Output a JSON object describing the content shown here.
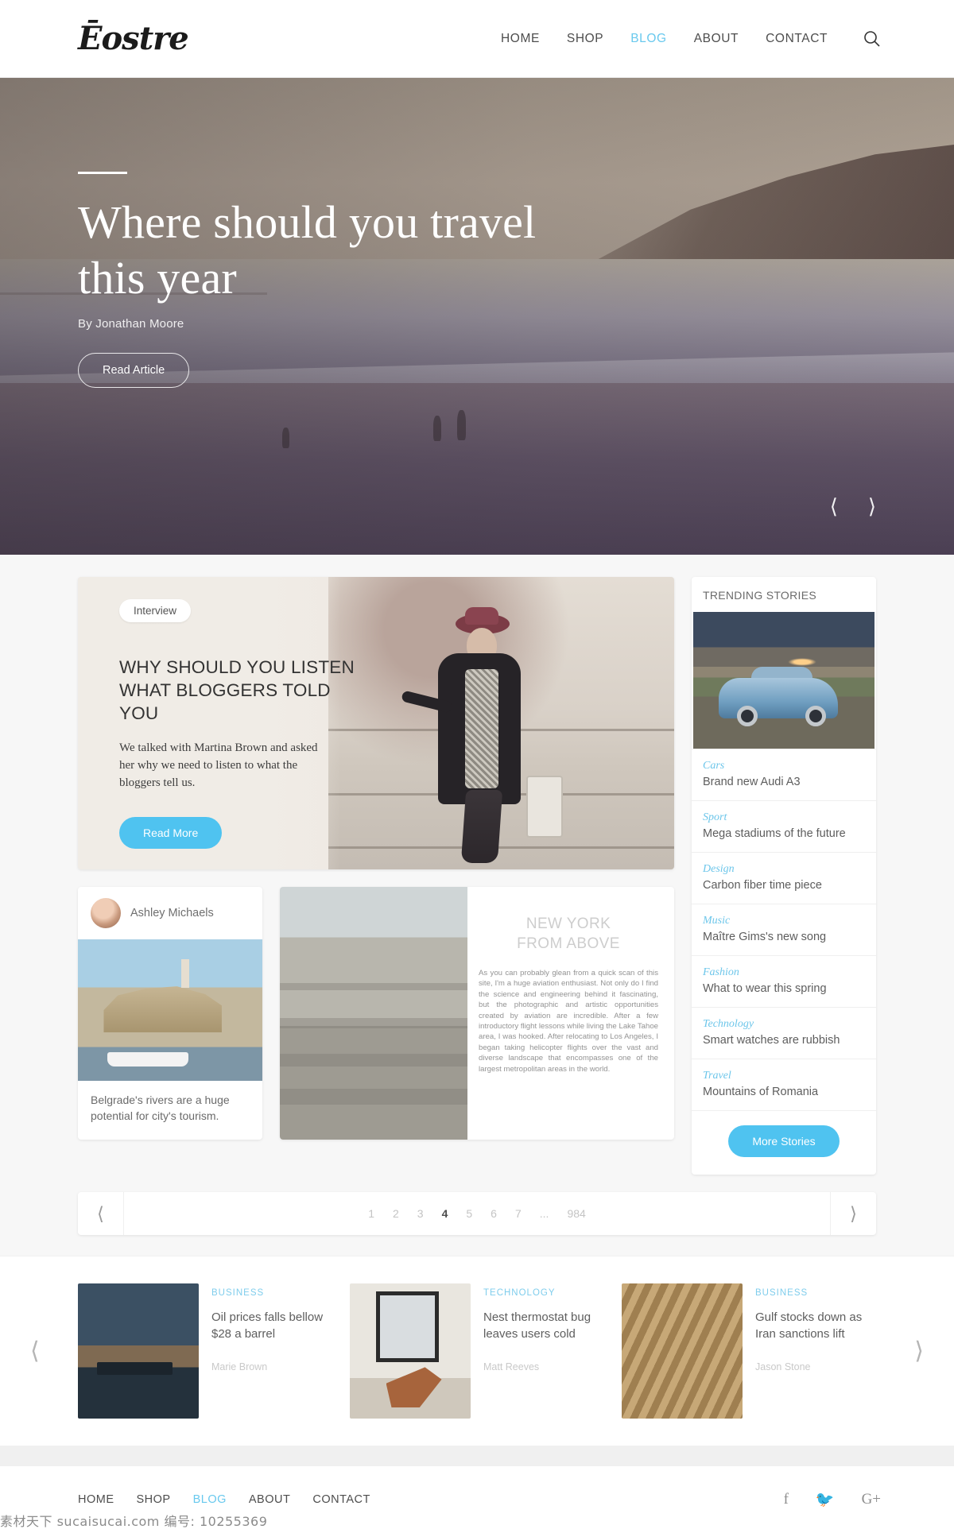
{
  "header": {
    "logo": "Ēostre",
    "nav": [
      {
        "label": "HOME",
        "active": false
      },
      {
        "label": "SHOP",
        "active": false
      },
      {
        "label": "BLOG",
        "active": true
      },
      {
        "label": "ABOUT",
        "active": false
      },
      {
        "label": "CONTACT",
        "active": false
      }
    ],
    "search_icon": "search-icon"
  },
  "hero": {
    "title": "Where should you travel this year",
    "byline": "By Jonathan Moore",
    "cta": "Read Article",
    "prev_icon": "chevron-left-icon",
    "next_icon": "chevron-right-icon"
  },
  "feature": {
    "tag": "Interview",
    "title": "WHY SHOULD YOU LISTEN WHAT BLOGGERS TOLD YOU",
    "description": "We talked with Martina Brown and asked her why we need to listen to what the bloggers tell us.",
    "cta": "Read More"
  },
  "author_card": {
    "name": "Ashley Michaels",
    "caption": "Belgrade's rivers are a huge potential for city's tourism."
  },
  "article_card": {
    "kicker_line1": "NEW YORK",
    "kicker_line2": "FROM ABOVE",
    "body": "As you can probably glean from a quick scan of this site, I'm a huge aviation enthusiast. Not only do I find the science and engineering behind it fascinating, but the photographic and artistic opportunities created by aviation are incredible. After a few introductory flight lessons while living the Lake Tahoe area, I was hooked. After relocating to Los Angeles, I began taking helicopter flights over the vast and diverse landscape that encompasses one of the largest metropolitan areas in the world."
  },
  "trending": {
    "heading": "TRENDING STORIES",
    "featured_alt": "Brand new Audi A3 at sunset",
    "items": [
      {
        "category": "Cars",
        "title": "Brand new Audi A3"
      },
      {
        "category": "Sport",
        "title": "Mega stadiums of the future"
      },
      {
        "category": "Design",
        "title": "Carbon fiber time piece"
      },
      {
        "category": "Music",
        "title": "Maître Gims's new song"
      },
      {
        "category": "Fashion",
        "title": "What to wear this spring"
      },
      {
        "category": "Technology",
        "title": "Smart watches are rubbish"
      },
      {
        "category": "Travel",
        "title": "Mountains of Romania"
      }
    ],
    "more_button": "More Stories"
  },
  "pagination": {
    "prev_icon": "chevron-left-icon",
    "next_icon": "chevron-right-icon",
    "pages": [
      "1",
      "2",
      "3",
      "4",
      "5",
      "6",
      "7",
      "...",
      "984"
    ],
    "current": "4"
  },
  "carousel": {
    "prev_icon": "chevron-left-icon",
    "next_icon": "chevron-right-icon",
    "items": [
      {
        "category": "BUSINESS",
        "title": "Oil prices falls bellow $28 a barrel",
        "author": "Marie Brown"
      },
      {
        "category": "TECHNOLOGY",
        "title": "Nest thermostat bug leaves users cold",
        "author": "Matt Reeves"
      },
      {
        "category": "BUSINESS",
        "title": "Gulf stocks down as Iran sanctions lift",
        "author": "Jason Stone"
      }
    ]
  },
  "footer": {
    "nav": [
      {
        "label": "HOME",
        "active": false
      },
      {
        "label": "SHOP",
        "active": false
      },
      {
        "label": "BLOG",
        "active": true
      },
      {
        "label": "ABOUT",
        "active": false
      },
      {
        "label": "CONTACT",
        "active": false
      }
    ],
    "socials": [
      "facebook-icon",
      "twitter-icon",
      "google-plus-icon"
    ],
    "watermark": "素材天下 sucaisucai.com 编号: 10255369"
  },
  "colors": {
    "accent": "#4fc3f0",
    "nav_active": "#69c9ee",
    "trending_category": "#6dc6ea"
  }
}
